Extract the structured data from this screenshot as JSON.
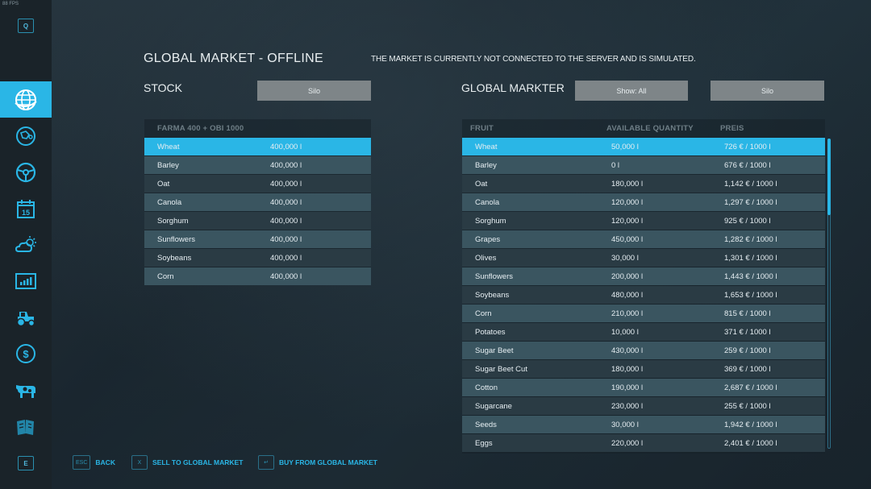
{
  "fps": "88 FPS",
  "sidebar": {
    "top_key": "Q",
    "bottom_key": "E",
    "items": [
      {
        "icon": "globe-icon",
        "active": true
      },
      {
        "icon": "map-icon",
        "active": false
      },
      {
        "icon": "steering-wheel-icon",
        "active": false
      },
      {
        "icon": "calendar-icon",
        "active": false,
        "calendar_day": "15"
      },
      {
        "icon": "weather-icon",
        "active": false
      },
      {
        "icon": "statistics-icon",
        "active": false
      },
      {
        "icon": "tractor-icon",
        "active": false
      },
      {
        "icon": "finance-icon",
        "active": false
      },
      {
        "icon": "cow-icon",
        "active": false
      },
      {
        "icon": "contracts-icon",
        "active": false
      }
    ]
  },
  "header": {
    "title": "GLOBAL MARKET - OFFLINE",
    "notice": "THE MARKET IS CURRENTLY NOT CONNECTED TO THE SERVER AND IS SIMULATED."
  },
  "stock": {
    "heading": "STOCK",
    "filter_button": "Silo",
    "table_title": "FARMA 400 + OBI 1000",
    "rows": [
      {
        "name": "Wheat",
        "qty": "400,000 l",
        "selected": true
      },
      {
        "name": "Barley",
        "qty": "400,000 l"
      },
      {
        "name": "Oat",
        "qty": "400,000 l"
      },
      {
        "name": "Canola",
        "qty": "400,000 l"
      },
      {
        "name": "Sorghum",
        "qty": "400,000 l"
      },
      {
        "name": "Sunflowers",
        "qty": "400,000 l"
      },
      {
        "name": "Soybeans",
        "qty": "400,000 l"
      },
      {
        "name": "Corn",
        "qty": "400,000 l"
      }
    ]
  },
  "market": {
    "heading": "GLOBAL MARKTER",
    "show_button": "Show: All",
    "silo_button": "Silo",
    "columns": [
      "FRUIT",
      "AVAILABLE QUANTITY",
      "PREIS"
    ],
    "rows": [
      {
        "name": "Wheat",
        "qty": "50,000 l",
        "price": "726 € / 1000 l",
        "selected": true
      },
      {
        "name": "Barley",
        "qty": "0 l",
        "price": "676 € / 1000 l"
      },
      {
        "name": "Oat",
        "qty": "180,000 l",
        "price": "1,142 € / 1000 l"
      },
      {
        "name": "Canola",
        "qty": "120,000 l",
        "price": "1,297 € / 1000 l"
      },
      {
        "name": "Sorghum",
        "qty": "120,000 l",
        "price": "925 € / 1000 l"
      },
      {
        "name": "Grapes",
        "qty": "450,000 l",
        "price": "1,282 € / 1000 l"
      },
      {
        "name": "Olives",
        "qty": "30,000 l",
        "price": "1,301 € / 1000 l"
      },
      {
        "name": "Sunflowers",
        "qty": "200,000 l",
        "price": "1,443 € / 1000 l"
      },
      {
        "name": "Soybeans",
        "qty": "480,000 l",
        "price": "1,653 € / 1000 l"
      },
      {
        "name": "Corn",
        "qty": "210,000 l",
        "price": "815 € / 1000 l"
      },
      {
        "name": "Potatoes",
        "qty": "10,000 l",
        "price": "371 € / 1000 l"
      },
      {
        "name": "Sugar Beet",
        "qty": "430,000 l",
        "price": "259 € / 1000 l"
      },
      {
        "name": "Sugar Beet Cut",
        "qty": "180,000 l",
        "price": "369 € / 1000 l"
      },
      {
        "name": "Cotton",
        "qty": "190,000 l",
        "price": "2,687 € / 1000 l"
      },
      {
        "name": "Sugarcane",
        "qty": "230,000 l",
        "price": "255 € / 1000 l"
      },
      {
        "name": "Seeds",
        "qty": "30,000 l",
        "price": "1,942 € / 1000 l"
      },
      {
        "name": "Eggs",
        "qty": "220,000 l",
        "price": "2,401 € / 1000 l"
      }
    ]
  },
  "footer": [
    {
      "key": "ESC",
      "label": "BACK"
    },
    {
      "key": "X",
      "label": "SELL TO GLOBAL MARKET"
    },
    {
      "key": "↵",
      "label": "BUY FROM GLOBAL MARKET"
    }
  ],
  "colors": {
    "accent": "#2ab6e6",
    "button": "#7e8588"
  }
}
